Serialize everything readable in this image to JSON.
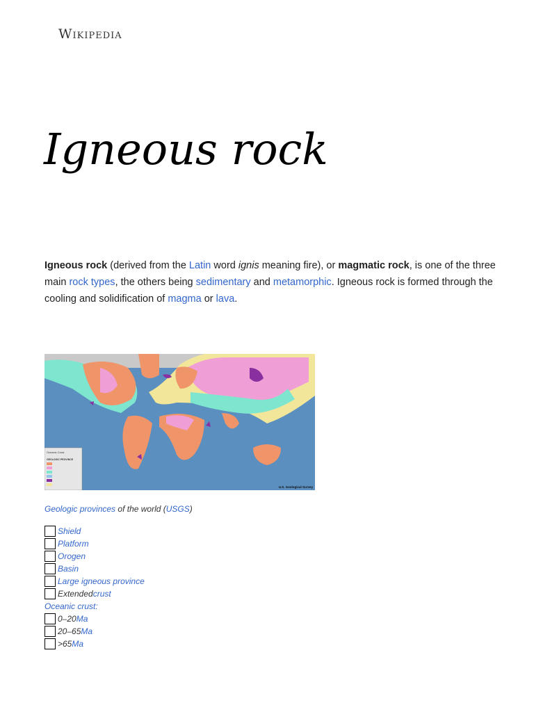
{
  "logo": "Wikipedia",
  "title": "Igneous rock",
  "intro": {
    "t1": "Igneous rock",
    "t2": " (derived from the ",
    "l1": "Latin",
    "t3": " word ",
    "t4": "ignis",
    "t5": " meaning fire), or ",
    "t6": "magmatic rock",
    "t7": ", is one of the three main ",
    "l2": "rock types",
    "t8": ", the others being ",
    "l3": "sedimentary",
    "t9": " and ",
    "l4": "metamorphic",
    "t10": ". Igneous rock is formed through the cooling and solidification of ",
    "l5": "magma",
    "t11": " or ",
    "l6": "lava",
    "t12": "."
  },
  "map": {
    "credit": "U.S. Geological Survey",
    "legend_title": "GEOLOGIC PROVINCE",
    "oceanic_title": "Oceanic Crust",
    "colors": {
      "shield": "#f0956a",
      "platform": "#ef9fd6",
      "orogen": "#7ee6cf",
      "basin": "#93c4ea",
      "lip": "#8a2fa0",
      "extended": "#f2e69a",
      "ocean": "#5a8fbf"
    }
  },
  "caption": {
    "l1": "Geologic provinces",
    "t1": " of the world (",
    "l2": "USGS",
    "t2": ")"
  },
  "legend": {
    "items": [
      {
        "pre": "",
        "link": "Shield"
      },
      {
        "pre": "",
        "link": "Platform"
      },
      {
        "pre": "",
        "link": "Orogen"
      },
      {
        "pre": "",
        "link": "Basin"
      },
      {
        "pre": "",
        "link": "Large igneous province"
      },
      {
        "pre": "Extended ",
        "link": "crust"
      }
    ],
    "oceanic": "Oceanic crust:",
    "oceanic_items": [
      {
        "pre": "0–20 ",
        "link": "Ma"
      },
      {
        "pre": "20–65 ",
        "link": "Ma"
      },
      {
        "pre": ">65 ",
        "link": "Ma"
      }
    ]
  }
}
